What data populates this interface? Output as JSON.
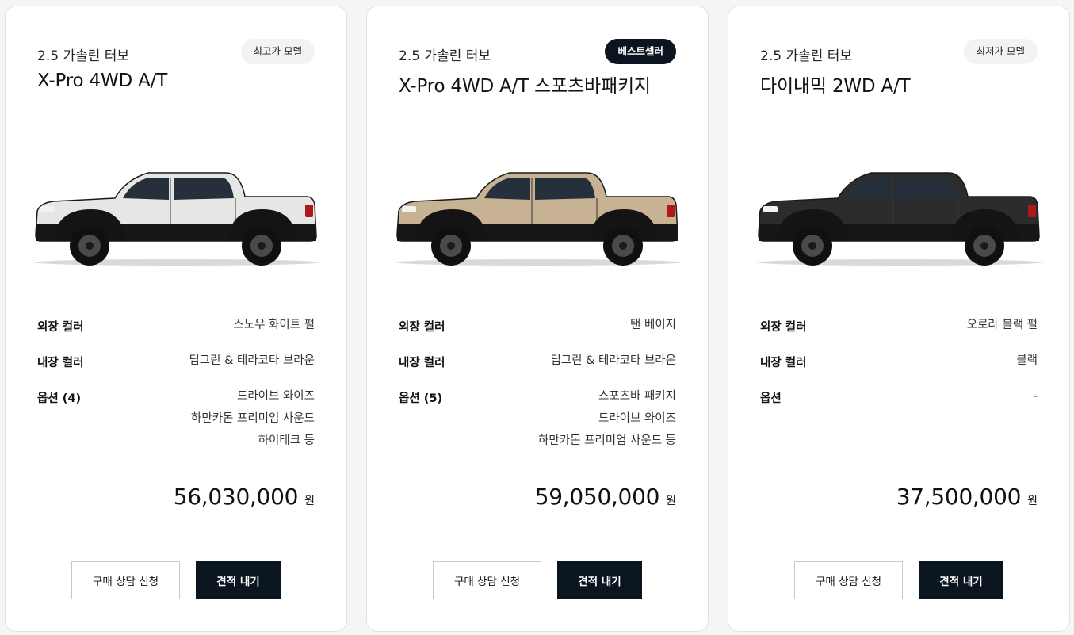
{
  "currency_unit": "원",
  "buttons": {
    "consult": "구매 상담 신청",
    "quote": "견적 내기"
  },
  "labels": {
    "exterior": "외장 컬러",
    "interior": "내장 컬러"
  },
  "cards": [
    {
      "engine": "2.5 가솔린 터보",
      "model": "X-Pro 4WD A/T",
      "badge": "최고가 모델",
      "badge_style": "light",
      "truck_color": "#e6e6e4",
      "exterior": "스노우 화이트 펄",
      "interior": "딥그린 & 테라코타 브라운",
      "options_label": "옵션 (4)",
      "options": [
        "드라이브 와이즈",
        "하만카돈 프리미엄 사운드",
        "하이테크 등"
      ],
      "price": "56,030,000"
    },
    {
      "engine": "2.5 가솔린 터보",
      "model": "X-Pro 4WD A/T 스포츠바패키지",
      "badge": "베스트셀러",
      "badge_style": "dark",
      "truck_color": "#c7b293",
      "exterior": "탠 베이지",
      "interior": "딥그린 & 테라코타 브라운",
      "options_label": "옵션 (5)",
      "options": [
        "스포츠바 패키지",
        "드라이브 와이즈",
        "하만카돈 프리미엄 사운드 등"
      ],
      "price": "59,050,000"
    },
    {
      "engine": "2.5 가솔린 터보",
      "model": "다이내믹 2WD A/T",
      "badge": "최저가 모델",
      "badge_style": "light",
      "truck_color": "#2c2c2c",
      "exterior": "오로라 블랙 펄",
      "interior": "블랙",
      "options_label": "옵션",
      "options": [
        "-"
      ],
      "price": "37,500,000"
    }
  ]
}
